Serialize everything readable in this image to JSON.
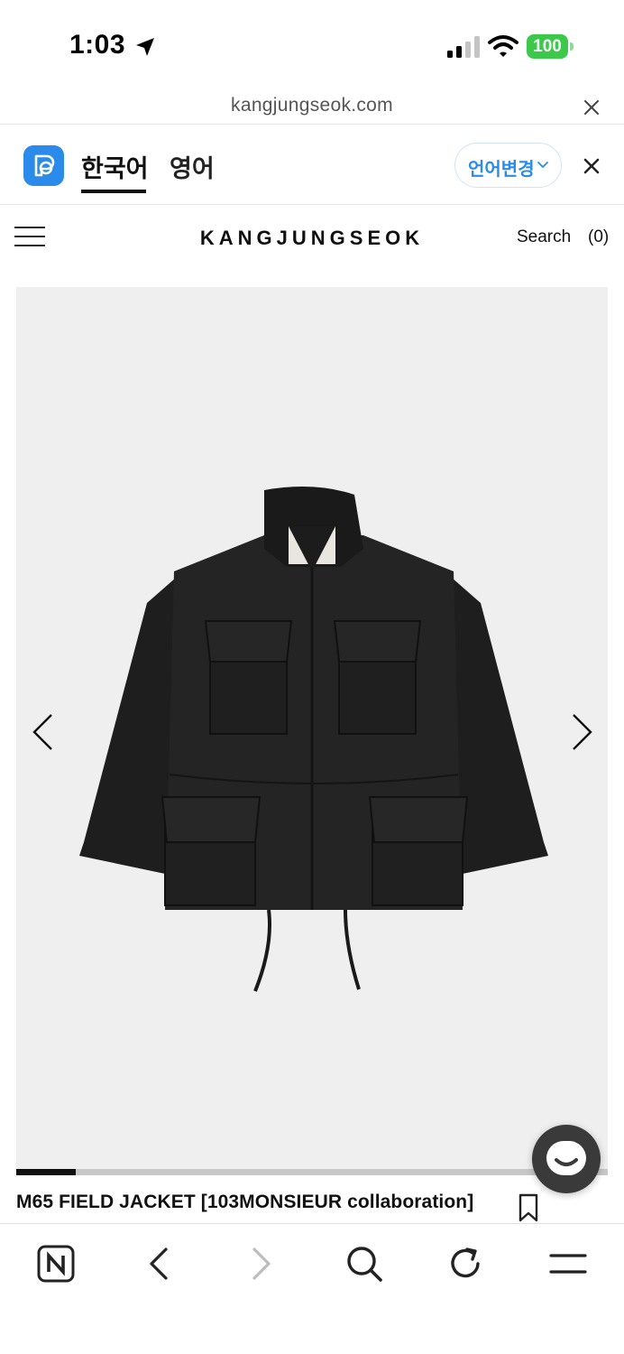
{
  "status_bar": {
    "time": "1:03",
    "battery": "100",
    "icons": [
      "location-arrow-icon",
      "signal-icon",
      "wifi-icon",
      "battery-icon"
    ]
  },
  "browser": {
    "url": "kangjungseok.com"
  },
  "translate_bar": {
    "tabs": [
      {
        "label": "한국어",
        "active": true
      },
      {
        "label": "영어",
        "active": false
      }
    ],
    "language_button": "언어변경",
    "accent_color": "#2a8bea"
  },
  "site": {
    "logo": "KANGJUNGSEOK",
    "search_label": "Search",
    "cart_count": "(0)"
  },
  "product": {
    "title": "M65 FIELD JACKET [103MONSIEUR collaboration]",
    "gallery_progress": 0.1
  },
  "toolbar": {
    "buttons": [
      "naver-n-icon",
      "back-icon",
      "forward-icon",
      "search-icon",
      "reload-icon",
      "menu-icon"
    ]
  }
}
